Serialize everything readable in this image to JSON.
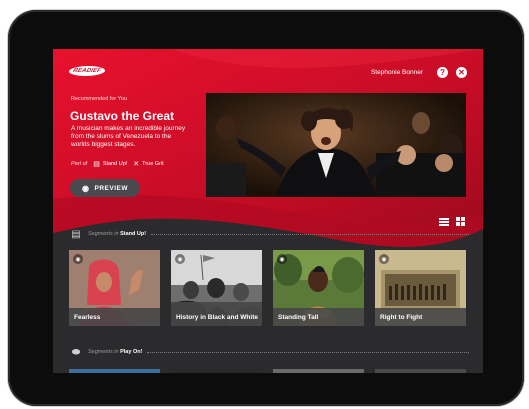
{
  "header": {
    "logo_text": "READIEF",
    "user_name": "Stephonie Bonner",
    "help_label": "?",
    "close_label": "✕"
  },
  "hero": {
    "recommended_label": "Recommended for You",
    "title": "Gustavo the Great",
    "description": "A musician makes an incredible journey from the slums of Venezuela to the worlds biggest stages.",
    "part_of_label": "Part of",
    "collections": [
      "Stand Up!",
      "True Grit"
    ],
    "preview_label": "PREVIEW"
  },
  "sections": [
    {
      "prefix": "Segments in",
      "name": "Stand Up!",
      "icon": "sign-icon",
      "cards": [
        {
          "title": "Fearless"
        },
        {
          "title": "History in Black and White"
        },
        {
          "title": "Standing Tall"
        },
        {
          "title": "Right to Fight"
        }
      ]
    },
    {
      "prefix": "Segments in",
      "name": "Play On!",
      "icon": "football-icon"
    }
  ],
  "colors": {
    "brand_red": "#c8102e",
    "dark_bg": "#2b2b2d"
  }
}
